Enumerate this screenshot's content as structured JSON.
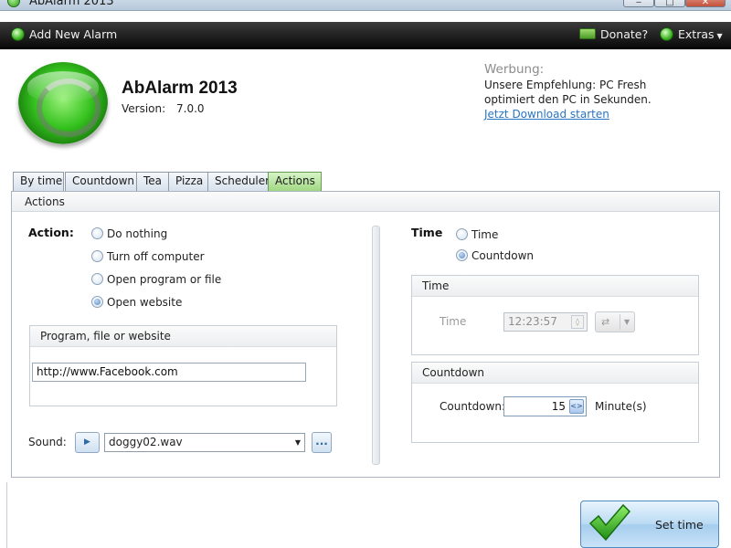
{
  "window": {
    "title": "AbAlarm 2013"
  },
  "toolbar": {
    "add_alarm": "Add New Alarm",
    "donate": "Donate?",
    "extras": "Extras"
  },
  "header": {
    "app_name": "AbAlarm 2013",
    "version_label": "Version:",
    "version_value": "7.0.0"
  },
  "ad": {
    "title": "Werbung:",
    "line1": "Unsere Empfehlung: PC Fresh",
    "line2": "optimiert den PC in Sekunden.",
    "link": "Jetzt Download starten"
  },
  "tabs": [
    {
      "label": "By time",
      "active": false
    },
    {
      "label": "Countdown",
      "active": false
    },
    {
      "label": "Tea",
      "active": false
    },
    {
      "label": "Pizza",
      "active": false
    },
    {
      "label": "Scheduler",
      "active": false
    },
    {
      "label": "Actions",
      "active": true
    }
  ],
  "panel": {
    "title": "Actions",
    "action_label": "Action:",
    "actions": [
      {
        "label": "Do nothing",
        "checked": false
      },
      {
        "label": "Turn off computer",
        "checked": false
      },
      {
        "label": "Open program or file",
        "checked": false
      },
      {
        "label": "Open website",
        "checked": true
      }
    ],
    "program_group_title": "Program, file or website",
    "program_value": "http://www.Facebook.com",
    "sound_label": "Sound:",
    "sound_value": "doggy02.wav",
    "browse_label": "...",
    "time_label": "Time",
    "time_modes": [
      {
        "label": "Time",
        "checked": false
      },
      {
        "label": "Countdown",
        "checked": true
      }
    ],
    "time_group_title": "Time",
    "time_field_label": "Time",
    "time_value": "12:23:57",
    "countdown_group_title": "Countdown",
    "countdown_field_label": "Countdown:",
    "countdown_value": "15",
    "countdown_unit": "Minute(s)"
  },
  "set_button": {
    "label": "Set time"
  },
  "colors": {
    "accent_green": "#35c21e",
    "active_tab": "#9ed67f",
    "link": "#2a74c2",
    "toolbar": "#111111"
  }
}
